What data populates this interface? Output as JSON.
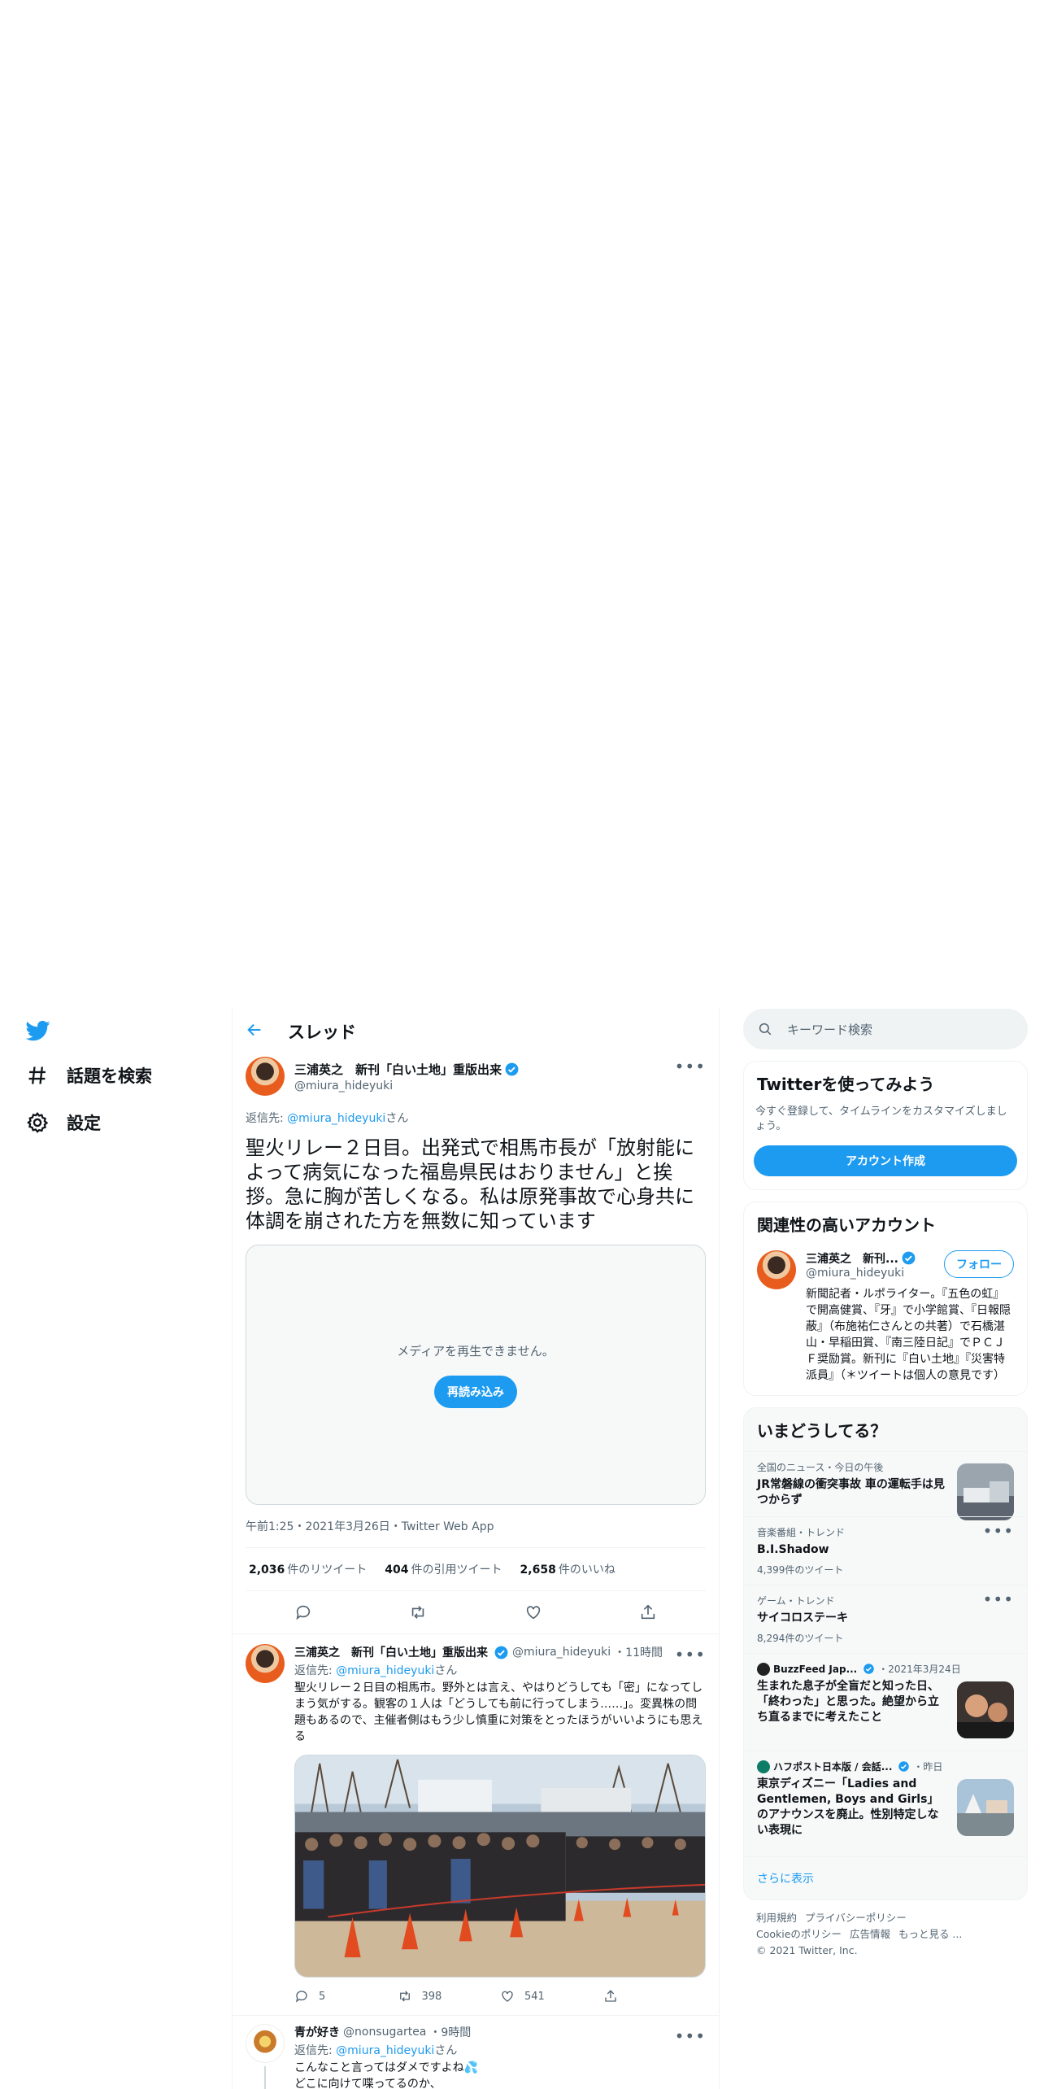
{
  "nav": {
    "explore_label": "話題を検索",
    "settings_label": "設定"
  },
  "header": {
    "title": "スレッド"
  },
  "focus_tweet": {
    "name": "三浦英之　新刊「白い土地」重版出来",
    "handle": "@miura_hideyuki",
    "reply_prefix": "返信先: ",
    "reply_handle": "@miura_hideyuki",
    "reply_suffix": "さん",
    "text": "聖火リレー２日目。出発式で相馬市長が「放射能によって病気になった福島県民はおりません」と挨拶。急に胸が苦しくなる。私は原発事故で心身共に体調を崩された方を無数に知っています",
    "media_message": "メディアを再生できません。",
    "reload_label": "再読み込み",
    "meta": "午前1:25・2021年3月26日・Twitter Web App",
    "retweets": "2,036",
    "retweets_label": "件のリツイート",
    "quotes": "404",
    "quotes_label": "件の引用ツイート",
    "likes": "2,658",
    "likes_label": "件のいいね"
  },
  "reply1": {
    "name": "三浦英之　新刊「白い土地」重版出来",
    "handle": "@miura_hideyuki",
    "time": "・11時間",
    "reply_prefix": "返信先: ",
    "reply_handle": "@miura_hideyuki",
    "reply_suffix": "さん",
    "text": "聖火リレー２日目の相馬市。野外とは言え、やはりどうしても「密」になってしまう気がする。観客の１人は「どうしても前に行ってしまう……」。変異株の問題もあるので、主催者側はもう少し慎重に対策をとったほうがいいようにも思える",
    "replies": "5",
    "retweets": "398",
    "likes": "541"
  },
  "reply2": {
    "name": "青が好き",
    "handle": "@nonsugartea",
    "time": "・9時間",
    "reply_prefix": "返信先: ",
    "reply_handle": "@miura_hideyuki",
    "reply_suffix": "さん",
    "text": "こんなこと言ってはダメですよね💦\nどこに向けて喋ってるのか、"
  },
  "search": {
    "placeholder": "キーワード検索"
  },
  "signup": {
    "title": "Twitterを使ってみよう",
    "desc": "今すぐ登録して、タイムラインをカスタマイズしましょう。",
    "button": "アカウント作成"
  },
  "related": {
    "title": "関連性の高いアカウント",
    "name": "三浦英之　新刊...",
    "handle": "@miura_hideyuki",
    "follow": "フォロー",
    "bio": "新聞記者・ルポライター。『五色の虹』で開高健賞、『牙』で小学館賞、『日報隠蔽』（布施祐仁さんとの共著）で石橋湛山・早稲田賞、『南三陸日記』でＰＣＪＦ奨励賞。新刊に『白い土地』『災害特派員』（＊ツイートは個人の意見です）"
  },
  "trends": {
    "title": "いまどうしてる？",
    "items": [
      {
        "context": "全国のニュース・今日の午後",
        "title": "JR常磐線の衝突事故 車の運転手は見つからず",
        "count": ""
      },
      {
        "context": "音楽番組・トレンド",
        "title": "B.I.Shadow",
        "count": "4,399件のツイート"
      },
      {
        "context": "ゲーム・トレンド",
        "title": "サイコロステーキ",
        "count": "8,294件のツイート"
      },
      {
        "context": "BuzzFeed Jap...",
        "context_time": "・2021年3月24日",
        "title": "生まれた息子が全盲だと知った日、「終わった」と思った。絶望から立ち直るまでに考えたこと",
        "count": ""
      },
      {
        "context": "ハフポスト日本版 / 会話...",
        "context_time": "・昨日",
        "title": "東京ディズニー「Ladies and Gentlemen, Boys and Girls」のアナウンスを廃止。性別特定しない表現に",
        "count": ""
      }
    ],
    "show_more": "さらに表示"
  },
  "footer": {
    "terms": "利用規約",
    "privacy": "プライバシーポリシー",
    "cookie": "Cookieのポリシー",
    "ads": "広告情報",
    "more": "もっと見る ...",
    "copyright": "© 2021 Twitter, Inc."
  },
  "colors": {
    "accent": "#1d9bf0",
    "muted": "#536471",
    "border": "#eff3f4"
  }
}
